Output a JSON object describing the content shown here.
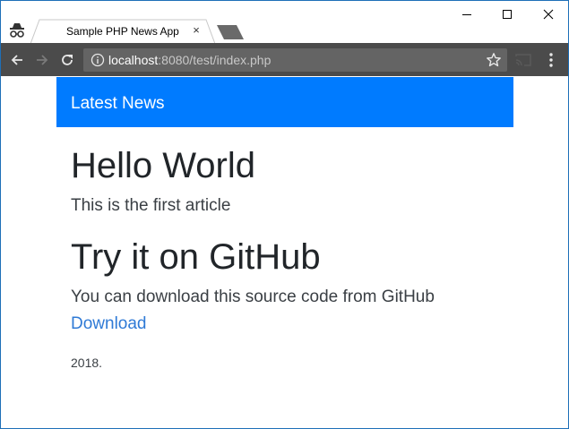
{
  "browser": {
    "tab": {
      "title": "Sample PHP News App",
      "close_glyph": "×"
    },
    "icons": {
      "incognito": "incognito-icon",
      "new_tab": "new-tab-icon",
      "minimize": "minimize-icon",
      "maximize": "maximize-icon",
      "close": "close-icon",
      "back": "back-arrow-icon",
      "forward": "forward-arrow-icon",
      "reload": "reload-icon",
      "info": "info-icon",
      "bookmark": "star-icon",
      "cast": "cast-icon",
      "menu": "kebab-menu-icon"
    },
    "address": {
      "host": "localhost",
      "rest": ":8080/test/index.php"
    }
  },
  "page": {
    "navbar": {
      "brand": "Latest News"
    },
    "articles": [
      {
        "title": "Hello World",
        "body": "This is the first article"
      },
      {
        "title": "Try it on GitHub",
        "body": "You can download this source code from GitHub"
      }
    ],
    "download_link": "Download",
    "footer": "2018."
  },
  "colors": {
    "navbar": "#007bff",
    "toolbar": "#4b4b4b",
    "link": "#2f7ad6",
    "window_border": "#1e6fb8"
  }
}
